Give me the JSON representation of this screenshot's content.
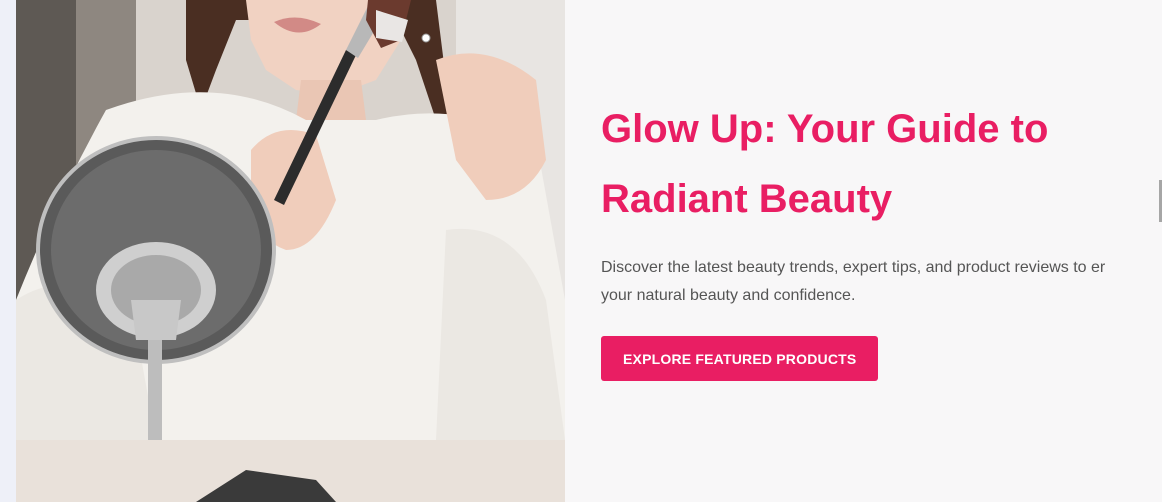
{
  "hero": {
    "image_label": "woman-applying-makeup-with-brush-photo",
    "title_line1": "Glow Up: Your Guide to",
    "title_line2": "Radiant Beauty",
    "description_line1": "Discover the latest beauty trends, expert tips, and product reviews to er",
    "description_line2": "your natural beauty and confidence.",
    "cta_label": "EXPLORE FEATURED PRODUCTS"
  },
  "colors": {
    "accent": "#e91e63",
    "background": "#f8f7f8",
    "text": "#555555"
  }
}
